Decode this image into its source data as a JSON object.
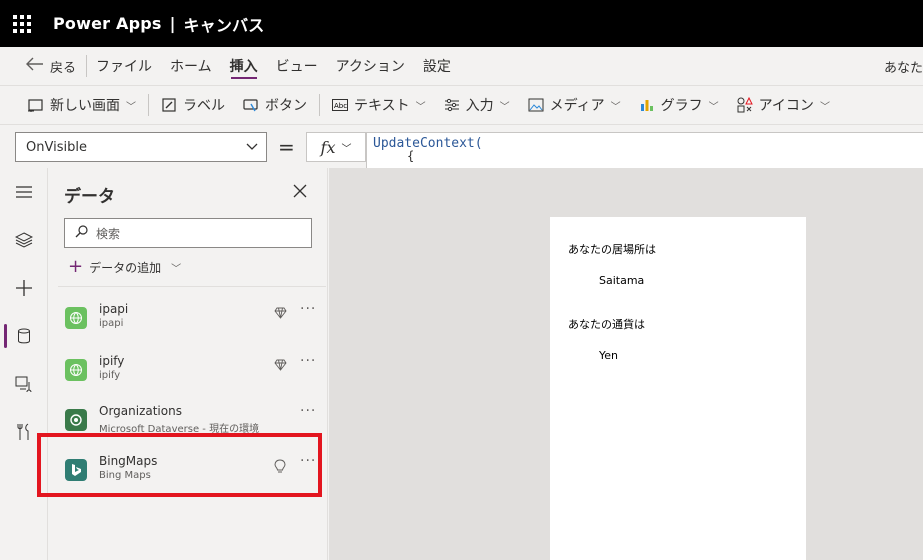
{
  "header": {
    "app_name": "Power Apps",
    "separator": "|",
    "canvas_label": "キャンバス"
  },
  "menu": {
    "back_label": "戻る",
    "items": [
      "ファイル",
      "ホーム",
      "挿入",
      "ビュー",
      "アクション",
      "設定"
    ],
    "active_index": 2,
    "user_text": "あなた"
  },
  "toolbar": {
    "items": [
      {
        "label": "新しい画面",
        "icon": "new-screen-icon",
        "chevron": true
      },
      {
        "label": "ラベル",
        "icon": "label-icon",
        "chevron": false
      },
      {
        "label": "ボタン",
        "icon": "button-icon",
        "chevron": false
      },
      {
        "label": "テキスト",
        "icon": "text-icon",
        "chevron": true
      },
      {
        "label": "入力",
        "icon": "input-icon",
        "chevron": true
      },
      {
        "label": "メディア",
        "icon": "media-icon",
        "chevron": true
      },
      {
        "label": "グラフ",
        "icon": "chart-icon",
        "chevron": true
      },
      {
        "label": "アイコン",
        "icon": "icons-icon",
        "chevron": true
      }
    ]
  },
  "formula": {
    "property": "OnVisible",
    "equals": "=",
    "fx": "fx",
    "line1": "UpdateContext(",
    "line2": "{"
  },
  "panel": {
    "title": "データ",
    "search_placeholder": "検索",
    "add_data_label": "データの追加",
    "data_sources": [
      {
        "name": "ipapi",
        "sub": "ipapi",
        "icon": "globe-icon",
        "color": "#6bc160",
        "badge": "diamond-icon"
      },
      {
        "name": "ipify",
        "sub": "ipify",
        "icon": "globe-icon",
        "color": "#6bc160",
        "badge": "diamond-icon"
      },
      {
        "name": "Organizations",
        "sub": "Microsoft Dataverse - 現在の環境",
        "icon": "dataverse-icon",
        "color": "#3a7a4a",
        "badge": ""
      },
      {
        "name": "BingMaps",
        "sub": "Bing Maps",
        "icon": "bing-icon",
        "color": "#2f7d73",
        "badge": "lightbulb-icon"
      }
    ]
  },
  "screen": {
    "label1": "あなたの居場所は",
    "value1": "Saitama",
    "label2": "あなたの通貨は",
    "value2": "Yen"
  },
  "colors": {
    "accent": "#742774",
    "highlight": "#e3151f",
    "header_bg": "#000000"
  }
}
